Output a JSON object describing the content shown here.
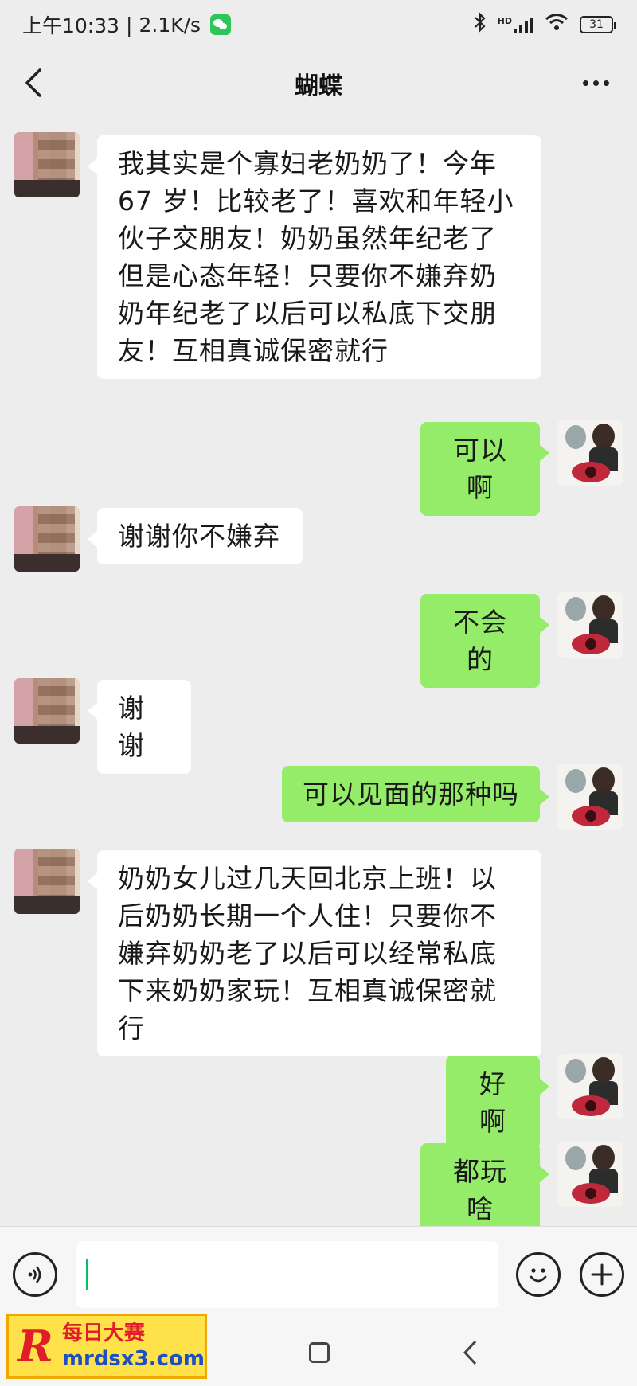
{
  "status_bar": {
    "time": "上午10:33",
    "net_speed": "2.1K/s",
    "hd_label": "HD",
    "battery": "31"
  },
  "header": {
    "title": "蝴蝶"
  },
  "messages": [
    {
      "sender": "other",
      "text": "我其实是个寡妇老奶奶了！今年 67 岁！比较老了！喜欢和年轻小伙子交朋友！奶奶虽然年纪老了但是心态年轻！只要你不嫌弃奶奶年纪老了以后可以私底下交朋友！互相真诚保密就行"
    },
    {
      "sender": "me",
      "text": "可以啊"
    },
    {
      "sender": "other",
      "text": "谢谢你不嫌弃"
    },
    {
      "sender": "me",
      "text": "不会的"
    },
    {
      "sender": "other",
      "text": "谢谢"
    },
    {
      "sender": "me",
      "text": "可以见面的那种吗"
    },
    {
      "sender": "other",
      "text": "奶奶女儿过几天回北京上班！以后奶奶长期一个人住！只要你不嫌弃奶奶老了以后可以经常私底下来奶奶家玩！互相真诚保密就行"
    },
    {
      "sender": "me",
      "text": "好啊"
    },
    {
      "sender": "me",
      "text": "都玩啥"
    }
  ],
  "input": {
    "value": ""
  },
  "watermark": {
    "logo": "R",
    "title": "每日大赛",
    "url": "mrdsx3.com"
  }
}
